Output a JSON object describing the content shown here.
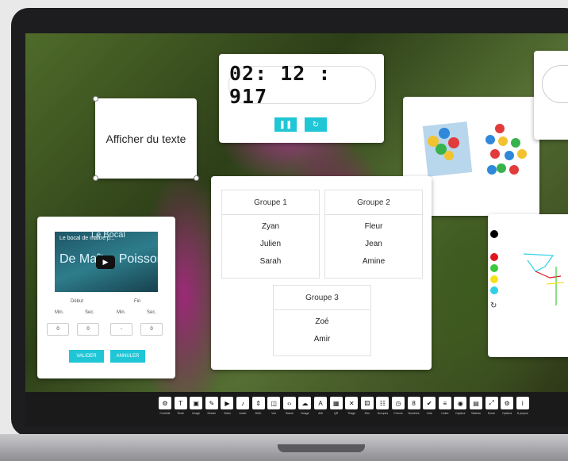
{
  "text_widget": {
    "label": "Afficher du texte"
  },
  "timer": {
    "display": "02: 12 : 917",
    "pause_icon": "pause-icon",
    "reset_icon": "reset-icon"
  },
  "groups": [
    {
      "title": "Groupe 1",
      "members": [
        "Zyan",
        "Julien",
        "Sarah"
      ]
    },
    {
      "title": "Groupe 2",
      "members": [
        "Fleur",
        "Jean",
        "Amine"
      ]
    },
    {
      "title": "Groupe 3",
      "members": [
        "Zoé",
        "Amir"
      ]
    }
  ],
  "video": {
    "channel_title": "Le bocal de maître p...",
    "overlay_text": "Le Bocal",
    "big_title": "De Maître Poisson",
    "debut_label": "Début",
    "fin_label": "Fin",
    "min_label": "Min.",
    "sec_label": "Sec.",
    "start_min": "0",
    "start_sec": "0",
    "end_min": "-",
    "end_sec": "0",
    "button_left": "VALIDER",
    "button_right": "ANNULER"
  },
  "drawing": {
    "colors": [
      "#000000",
      "#e0161e",
      "#3cc93c",
      "#f6e21b",
      "#2fd0e6"
    ]
  },
  "toolbar": {
    "tools": [
      {
        "icon": "settings-icon",
        "label": "Contrôle"
      },
      {
        "icon": "text-icon",
        "label": "Texte"
      },
      {
        "icon": "image-icon",
        "label": "Image"
      },
      {
        "icon": "shapes-icon",
        "label": "Dessin"
      },
      {
        "icon": "video-icon",
        "label": "Vidéo"
      },
      {
        "icon": "audio-icon",
        "label": "Audio"
      },
      {
        "icon": "scroll-icon",
        "label": "Défil."
      },
      {
        "icon": "view-icon",
        "label": "Vue"
      },
      {
        "icon": "iframe-icon",
        "label": "Iframe"
      },
      {
        "icon": "cloud-icon",
        "label": "Nuage"
      },
      {
        "icon": "ab-icon",
        "label": "A/B"
      },
      {
        "icon": "qr-icon",
        "label": "QR"
      },
      {
        "icon": "cross-icon",
        "label": "Tirage"
      },
      {
        "icon": "dice-icon",
        "label": "Dés"
      },
      {
        "icon": "groups-icon",
        "label": "Groupes"
      },
      {
        "icon": "timer-icon",
        "label": "Chrono"
      },
      {
        "icon": "number-icon",
        "label": "Nombres"
      },
      {
        "icon": "like-icon",
        "label": "Vote"
      },
      {
        "icon": "list-icon",
        "label": "Listes"
      },
      {
        "icon": "capture-icon",
        "label": "Capture"
      },
      {
        "icon": "board-icon",
        "label": "Tableau"
      },
      {
        "icon": "expand-icon",
        "label": "Écran"
      },
      {
        "icon": "gear-icon",
        "label": "Options"
      },
      {
        "icon": "info-icon",
        "label": "À propos"
      }
    ]
  }
}
